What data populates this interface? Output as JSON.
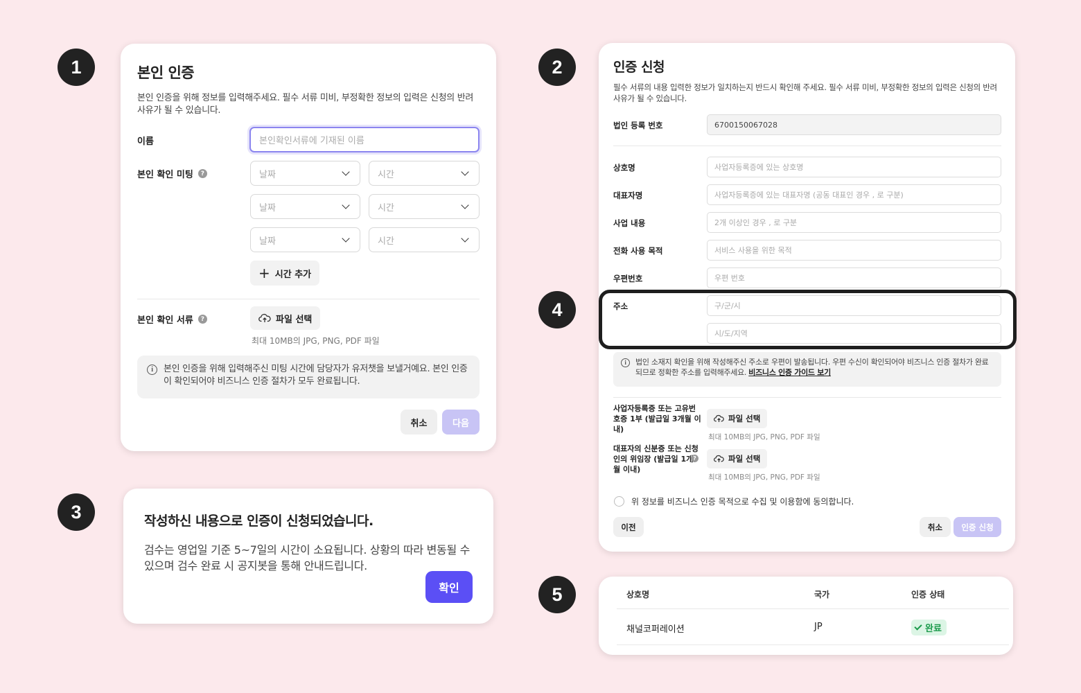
{
  "markers": [
    "1",
    "2",
    "3",
    "4",
    "5"
  ],
  "identity": {
    "title": "본인 인증",
    "description": "본인 인증을 위해 정보를 입력해주세요. 필수 서류 미비, 부정확한 정보의 입력은 신청의 반려 사유가 될 수 있습니다.",
    "name_label": "이름",
    "name_placeholder": "본인확인서류에 기재된 이름",
    "meeting_label": "본인 확인 미팅",
    "date_placeholder": "날짜",
    "time_placeholder": "시간",
    "add_time_label": "시간 추가",
    "document_label": "본인 확인 서류",
    "file_select_label": "파일 선택",
    "file_hint": "최대 10MB의 JPG, PNG, PDF 파일",
    "info_text": "본인 인증을 위해 입력해주신 미팅 시간에 담당자가 유저챗을 보낼거예요. 본인 인증이 확인되어야 비즈니스 인증 절차가 모두 완료됩니다.",
    "cancel_label": "취소",
    "next_label": "다음"
  },
  "application": {
    "title": "인증 신청",
    "description": "필수 서류의 내용 입력한 정보가 일치하는지 반드시 확인해 주세요. 필수 서류 미비, 부정확한 정보의 입력은 신청의 반려 사유가 될 수 있습니다.",
    "reg_number_label": "법인 등록 번호",
    "reg_number_value": "6700150067028",
    "company_label": "상호명",
    "company_placeholder": "사업자등록증에 있는 상호명",
    "ceo_label": "대표자명",
    "ceo_placeholder": "사업자등록증에 있는 대표자명 (공동 대표인 경우 , 로 구분)",
    "business_label": "사업 내용",
    "business_placeholder": "2개 이상인 경우 , 로 구분",
    "purpose_label": "전화 사용 목적",
    "purpose_placeholder": "서비스 사용을 위한 목적",
    "zip_label": "우편번호",
    "zip_placeholder": "우편 번호",
    "address_label": "주소",
    "address1_placeholder": "구/군/시",
    "address2_placeholder": "시/도/지역",
    "info_text": "법인 소재지 확인을 위해 작성해주신 주소로 우편이 발송됩니다. 우편 수신이 확인되어야 비즈니스 인증 절차가 완료되므로 정확한 주소를 입력해주세요.",
    "info_link": "비즈니스 인증 가이드 보기",
    "doc1_label": "사업자등록증 또는 고유번호증 1부 (발급일 3개월 이내)",
    "doc2_label": "대표자의 신분증 또는 신청인의 위임장 (발급일 1개월 이내)",
    "file_select_label": "파일 선택",
    "file_hint": "최대 10MB의 JPG, PNG, PDF 파일",
    "agree_text": "위 정보를 비즈니스 인증 목적으로 수집 및 이용함에 동의합니다.",
    "prev_label": "이전",
    "cancel_label": "취소",
    "submit_label": "인증 신청"
  },
  "confirm": {
    "title": "작성하신 내용으로 인증이 신청되었습니다.",
    "body": "검수는 영업일 기준 5~7일의 시간이 소요됩니다. 상황의 따라 변동될 수 있으며 검수 완료 시 공지봇을 통해 안내드립니다.",
    "ok_label": "확인"
  },
  "status_table": {
    "headers": [
      "상호명",
      "국가",
      "인증 상태"
    ],
    "row": {
      "company": "채널코퍼레이션",
      "country": "JP",
      "status": "완료"
    }
  },
  "colors": {
    "background": "#fce9ec",
    "primary": "#5b4ff5",
    "disabled": "#c8c4f5",
    "success": "#1b9a4b"
  }
}
